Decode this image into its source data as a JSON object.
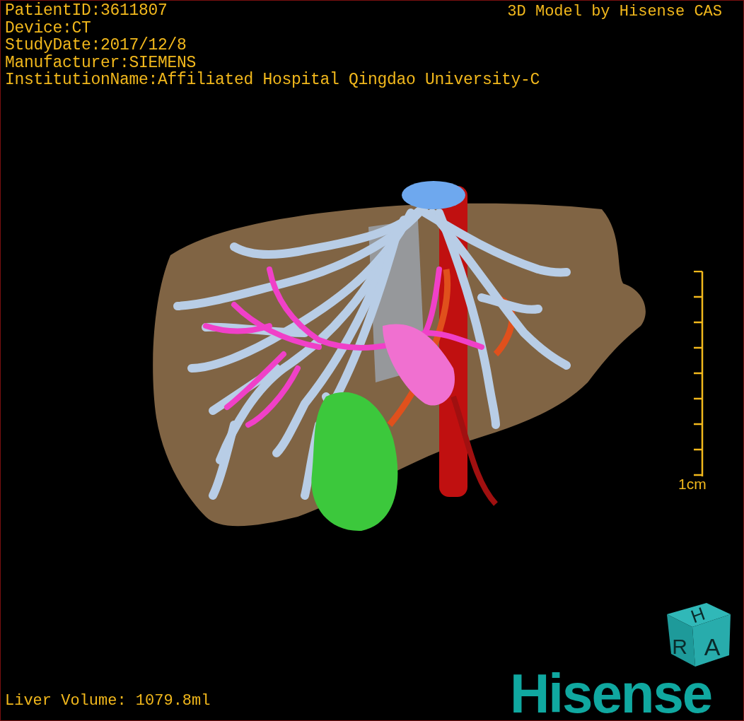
{
  "info": [
    "PatientID:3611807",
    "Device:CT",
    "StudyDate:2017/12/8",
    "Manufacturer:SIEMENS",
    "InstitutionName:Affiliated Hospital Qingdao University-C"
  ],
  "title": "3D Model by Hisense CAS",
  "scale": {
    "label": "1cm"
  },
  "cube": {
    "top": "H",
    "left": "R",
    "front": "A"
  },
  "volume": "Liver Volume: 1079.8ml",
  "logo": "Hisense"
}
